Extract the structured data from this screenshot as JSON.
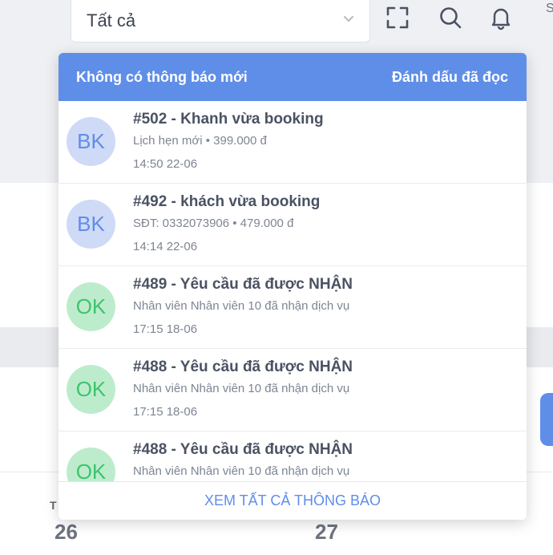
{
  "filter": {
    "value": "Tất cả"
  },
  "edge_letter": "S",
  "calendar": {
    "weekday": "T",
    "days": [
      "26",
      "27"
    ]
  },
  "notifications": {
    "header_title": "Không có thông báo mới",
    "mark_read_label": "Đánh dấu đã đọc",
    "items": [
      {
        "avatar": "BK",
        "title": "#502 - Khanh vừa booking",
        "desc": "Lịch hẹn mới • 399.000 đ",
        "time": "14:50 22-06"
      },
      {
        "avatar": "BK",
        "title": "#492 - khách vừa booking",
        "desc": "SĐT: 0332073906 • 479.000 đ",
        "time": "14:14 22-06"
      },
      {
        "avatar": "OK",
        "title": "#489 - Yêu cầu đã được NHẬN",
        "desc": "Nhân viên Nhân viên 10 đã nhận dịch vụ",
        "time": "17:15 18-06"
      },
      {
        "avatar": "OK",
        "title": "#488 - Yêu cầu đã được NHẬN",
        "desc": "Nhân viên Nhân viên 10 đã nhận dịch vụ",
        "time": "17:15 18-06"
      },
      {
        "avatar": "OK",
        "title": "#488 - Yêu cầu đã được NHẬN",
        "desc": "Nhân viên Nhân viên 10 đã nhận dịch vụ",
        "time": ""
      }
    ],
    "view_all_label": "XEM TẤT CẢ THÔNG BÁO"
  },
  "colors": {
    "accent": "#5f8ee8",
    "bk_bg": "#cfdaf7",
    "ok_bg": "#bdeccd",
    "ok_fg": "#3ec46d"
  },
  "icons": [
    "chevron-down-icon",
    "fullscreen-icon",
    "search-icon",
    "bell-icon"
  ]
}
